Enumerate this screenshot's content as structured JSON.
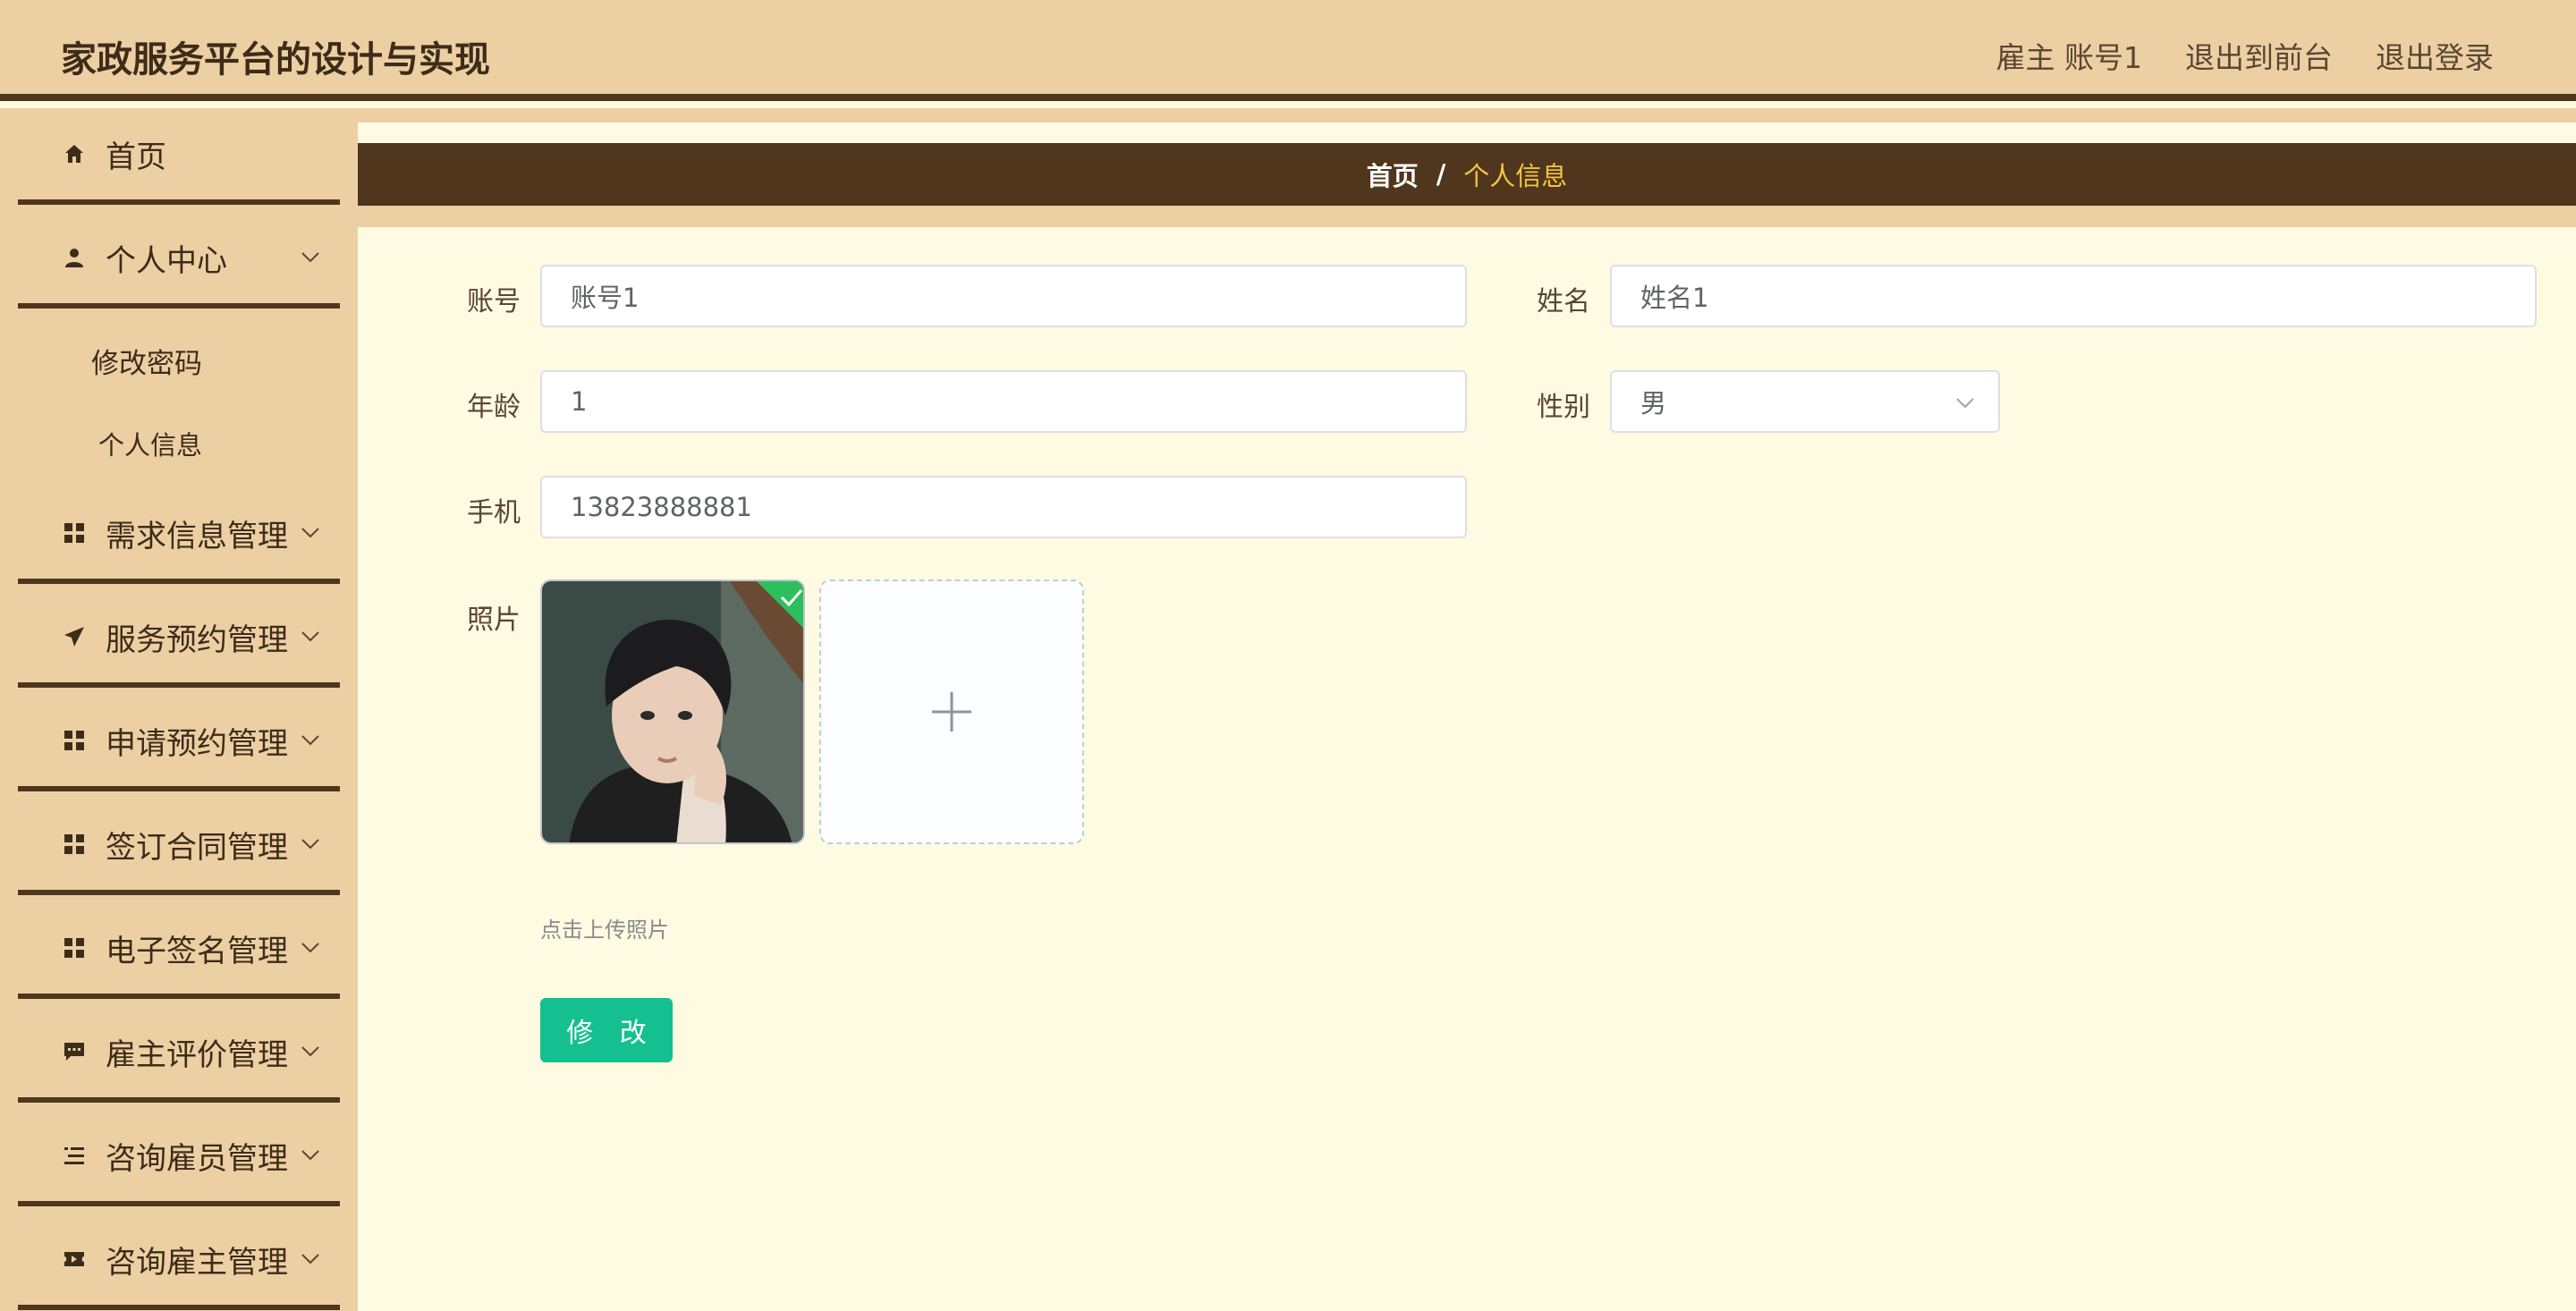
{
  "header": {
    "title": "家政服务平台的设计与实现",
    "user": "雇主 账号1",
    "to_front": "退出到前台",
    "logout": "退出登录"
  },
  "sidebar": {
    "items": [
      {
        "label": "首页",
        "icon": "home-icon"
      },
      {
        "label": "个人中心",
        "icon": "user-icon",
        "sub": [
          "修改密码",
          "个人信息"
        ]
      },
      {
        "label": "需求信息管理",
        "icon": "grid-icon"
      },
      {
        "label": "服务预约管理",
        "icon": "send-icon"
      },
      {
        "label": "申请预约管理",
        "icon": "grid-icon"
      },
      {
        "label": "签订合同管理",
        "icon": "grid-icon"
      },
      {
        "label": "电子签名管理",
        "icon": "grid-icon"
      },
      {
        "label": "雇主评价管理",
        "icon": "comment-icon"
      },
      {
        "label": "咨询雇员管理",
        "icon": "list-icon"
      },
      {
        "label": "咨询雇主管理",
        "icon": "ticket-icon"
      }
    ]
  },
  "breadcrumb": {
    "home": "首页",
    "separator": "/",
    "current": "个人信息"
  },
  "form": {
    "account": {
      "label": "账号",
      "value": "账号1"
    },
    "name": {
      "label": "姓名",
      "value": "姓名1"
    },
    "age": {
      "label": "年龄",
      "value": "1"
    },
    "gender": {
      "label": "性别",
      "value": "男"
    },
    "phone": {
      "label": "手机",
      "value": "13823888881"
    },
    "photo": {
      "label": "照片",
      "hint": "点击上传照片"
    },
    "submit": "修 改"
  },
  "colors": {
    "header_bg": "#edcfa4",
    "accent_dark": "#4f361d",
    "content_bg": "#fffbe3",
    "breadcrumb_current": "#f3c443",
    "button": "#14c08f"
  }
}
